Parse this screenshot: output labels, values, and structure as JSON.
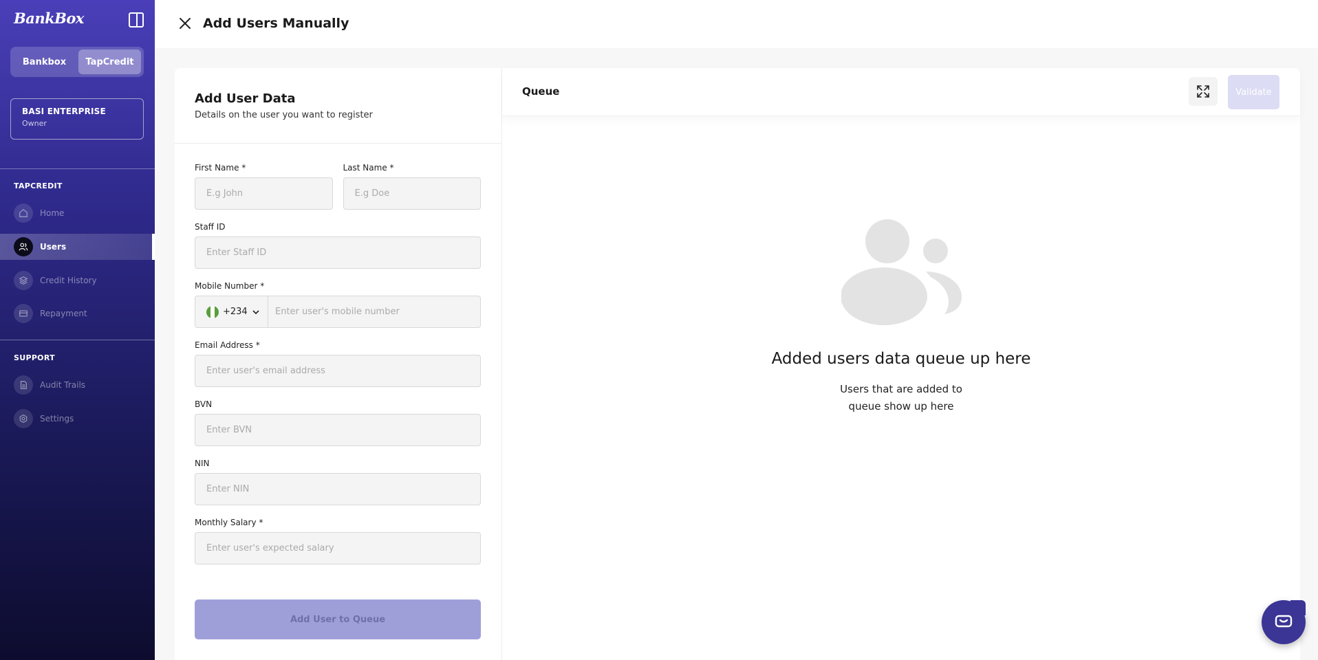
{
  "sidebar": {
    "logo": "BankBox",
    "switcher": [
      "Bankbox",
      "TapCredit"
    ],
    "org": {
      "name": "BASI ENTERPRISE",
      "role": "Owner"
    },
    "sections": [
      {
        "label": "TAPCREDIT",
        "items": [
          {
            "label": "Home",
            "icon": "home-icon"
          },
          {
            "label": "Users",
            "icon": "users-icon",
            "active": true
          },
          {
            "label": "Credit History",
            "icon": "layers-icon"
          },
          {
            "label": "Repayment",
            "icon": "wallet-icon"
          }
        ]
      },
      {
        "label": "SUPPORT",
        "items": [
          {
            "label": "Audit Trails",
            "icon": "document-icon"
          },
          {
            "label": "Settings",
            "icon": "gear-icon"
          }
        ]
      }
    ]
  },
  "header": {
    "title": "Add Users Manually"
  },
  "form": {
    "title": "Add User Data",
    "subtitle": "Details on the user you want to register",
    "first_name": {
      "label": "First Name *",
      "placeholder": "E.g John"
    },
    "last_name": {
      "label": "Last Name *",
      "placeholder": "E.g Doe"
    },
    "staff_id": {
      "label": "Staff ID",
      "placeholder": "Enter Staff ID"
    },
    "mobile": {
      "label": "Mobile Number *",
      "code": "+234",
      "placeholder": "Enter user's mobile number"
    },
    "email": {
      "label": "Email Address *",
      "placeholder": "Enter user's email address"
    },
    "bvn": {
      "label": "BVN",
      "placeholder": "Enter BVN"
    },
    "nin": {
      "label": "NIN",
      "placeholder": "Enter NIN"
    },
    "salary": {
      "label": "Monthly Salary *",
      "placeholder": "Enter user's expected salary"
    },
    "submit_label": "Add User to Queue"
  },
  "queue": {
    "title": "Queue",
    "validate_label": "Validate",
    "empty_title": "Added users data queue up here",
    "empty_subtitle": "Users that are added to queue show up here"
  },
  "colors": {
    "brand": "#3b3596",
    "button_disabled": "#9e9fd9",
    "validate_disabled": "#dcdcf5"
  }
}
